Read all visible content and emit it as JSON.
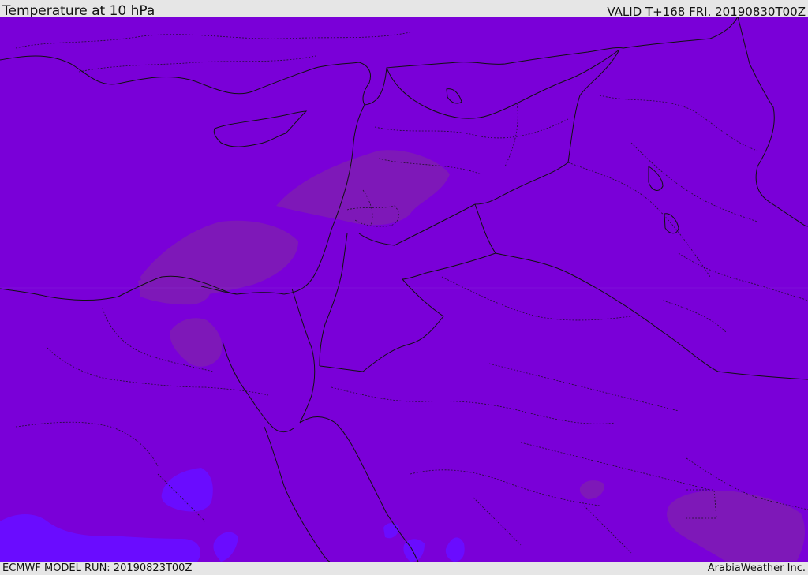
{
  "header": {
    "title": "Temperature at 10 hPa",
    "valid": "VALID T+168 FRI. 20190830T00Z"
  },
  "footer": {
    "model_run": "ECMWF MODEL RUN: 20190823T00Z",
    "credit": "ArabiaWeather Inc."
  },
  "map": {
    "region": "Eastern Mediterranean and Middle East",
    "colors": {
      "background_field": "#7a00d8",
      "warmer_patches": "#7e18b8",
      "cooler_patches": "#6a0cff",
      "borders": "#111111"
    }
  }
}
